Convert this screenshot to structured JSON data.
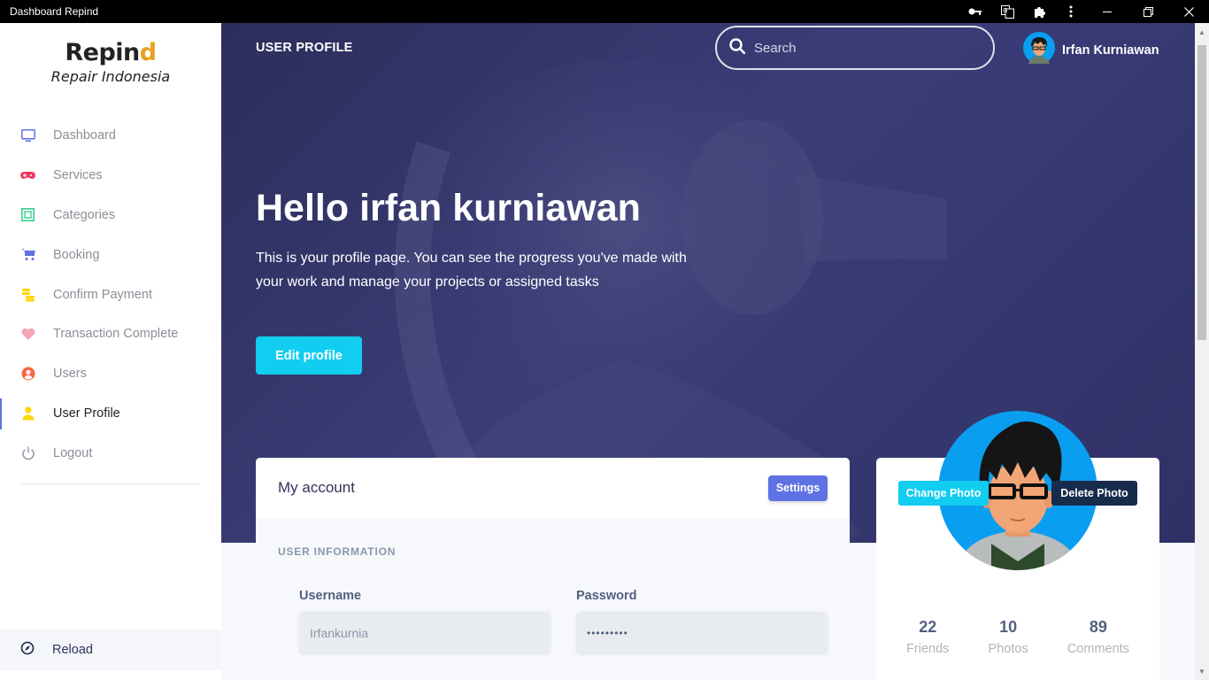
{
  "window": {
    "title": "Dashboard Repind"
  },
  "brand": {
    "name_main": "Repin",
    "name_accent": "d",
    "subtitle": "Repair Indonesia"
  },
  "sidebar": {
    "items": [
      {
        "label": "Dashboard",
        "icon": "monitor-icon",
        "color": "#5e72e4"
      },
      {
        "label": "Services",
        "icon": "gamepad-icon",
        "color": "#f5365c"
      },
      {
        "label": "Categories",
        "icon": "grid-icon",
        "color": "#2dce89"
      },
      {
        "label": "Booking",
        "icon": "cart-icon",
        "color": "#5e72e4"
      },
      {
        "label": "Confirm Payment",
        "icon": "coins-icon",
        "color": "#ffd600"
      },
      {
        "label": "Transaction Complete",
        "icon": "heart-icon",
        "color": "#f3a4b5"
      },
      {
        "label": "Users",
        "icon": "user-circle-icon",
        "color": "#fb6340"
      },
      {
        "label": "User Profile",
        "icon": "person-icon",
        "color": "#ffd600"
      },
      {
        "label": "Logout",
        "icon": "power-icon",
        "color": "#8898aa"
      }
    ],
    "active_index": 7,
    "reload_label": "Reload"
  },
  "header": {
    "page_title": "USER PROFILE",
    "search_placeholder": "Search",
    "user_name": "Irfan Kurniawan"
  },
  "hero": {
    "greeting": "Hello irfan kurniawan",
    "intro": "This is your profile page. You can see the progress you've made with your work and manage your projects or assigned tasks",
    "edit_button": "Edit profile"
  },
  "account": {
    "title": "My account",
    "settings_button": "Settings",
    "section_label": "USER INFORMATION",
    "username_label": "Username",
    "username_value": "Irfankurnia",
    "password_label": "Password",
    "password_value": "•••••••••"
  },
  "profile": {
    "change_photo": "Change Photo",
    "delete_photo": "Delete Photo",
    "stats": [
      {
        "value": "22",
        "label": "Friends"
      },
      {
        "value": "10",
        "label": "Photos"
      },
      {
        "value": "89",
        "label": "Comments"
      }
    ]
  },
  "colors": {
    "primary": "#5e72e4",
    "info": "#11cdef",
    "dark": "#172b4d",
    "hero": "#2c2e5a"
  }
}
